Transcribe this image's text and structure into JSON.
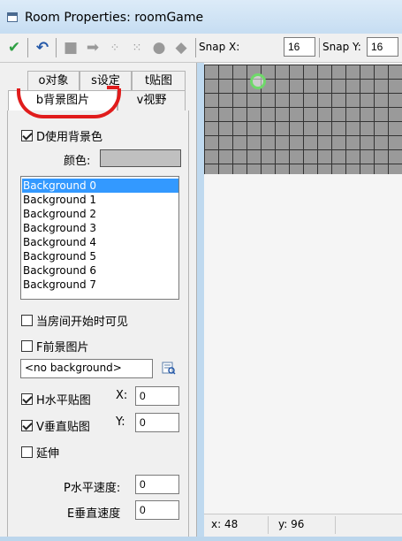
{
  "window": {
    "title": "Room Properties: roomGame"
  },
  "toolbar": {
    "icons": [
      "check-icon",
      "undo-icon",
      "clear-icon",
      "shift-icon",
      "align-icon",
      "snap-icon",
      "lock-icon",
      "object-icon"
    ],
    "snap_x_label": "Snap X:",
    "snap_x_value": "16",
    "snap_y_label": "Snap Y:",
    "snap_y_value": "16"
  },
  "tabs": {
    "row1": [
      "o对象",
      "s设定",
      "t贴图"
    ],
    "row2": [
      "b背景图片",
      "v视野"
    ],
    "active": "b背景图片"
  },
  "backgrounds": {
    "use_bg_color_label": "D使用背景色",
    "use_bg_color_checked": true,
    "color_label": "颜色:",
    "color_value": "#c0c0c0",
    "list": [
      "Background 0",
      "Background 1",
      "Background 2",
      "Background 3",
      "Background 4",
      "Background 5",
      "Background 6",
      "Background 7"
    ],
    "selected_index": 0,
    "visible_at_start_label": "当房间开始时可见",
    "foreground_label": "F前景图片",
    "background_select": "<no background>",
    "tile_h_label": "H水平贴图",
    "tile_v_label": "V垂直贴图",
    "x_label": "X:",
    "x_value": "0",
    "y_label": "Y:",
    "y_value": "0",
    "stretch_label": "延伸",
    "hspeed_label": "P水平速度:",
    "hspeed_value": "0",
    "vspeed_label": "E垂直速度",
    "vspeed_value": "0"
  },
  "status": {
    "x": "x: 48",
    "y": "y: 96"
  },
  "colors": {
    "annotation": "#e01c1c",
    "selection": "#3399ff",
    "confirm": "#2ea043",
    "undo": "#2458a8"
  }
}
